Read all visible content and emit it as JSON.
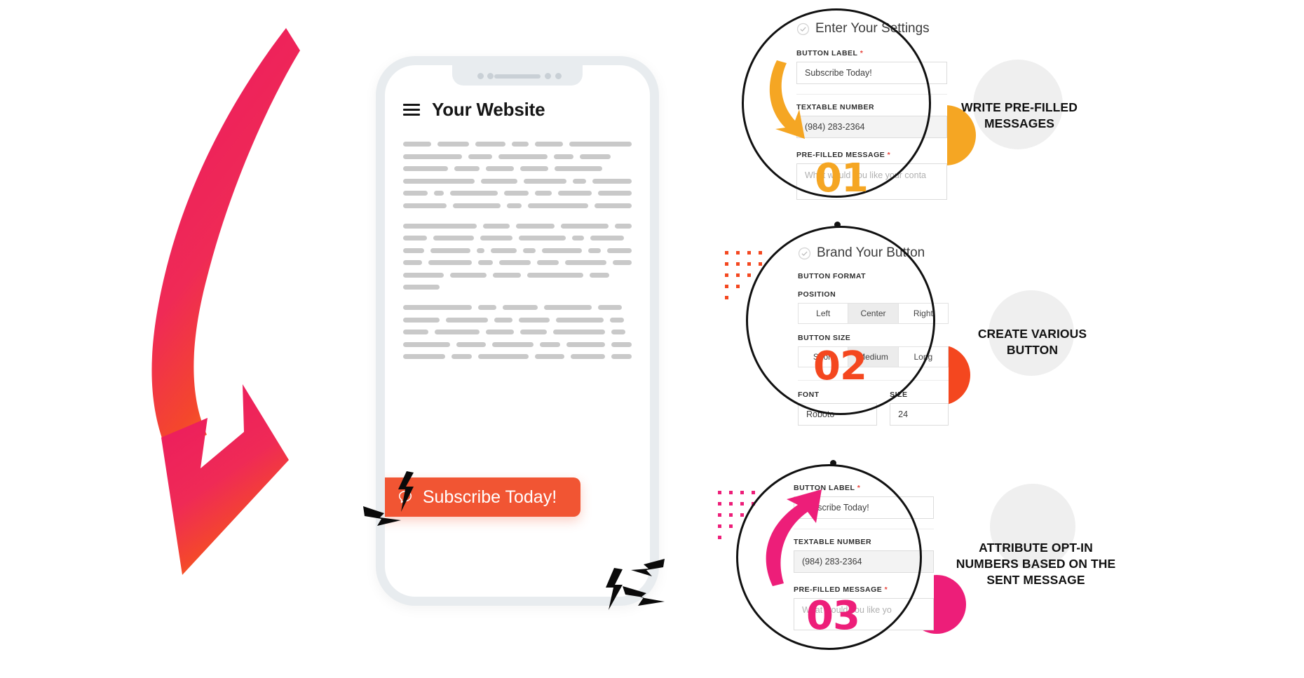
{
  "phone": {
    "site_title": "Your Website",
    "menu_icon": "hamburger-icon",
    "subscribe_button_label": "Subscribe Today!",
    "subscribe_button_icon": "chat-bubble-icon",
    "subscribe_button_color": "#f15533"
  },
  "steps": [
    {
      "number": "01",
      "accent": "#f5a623",
      "title": "Enter Your Settings",
      "status_icon": "check-circle-icon",
      "fields": [
        {
          "label": "BUTTON LABEL",
          "required": true,
          "value": "Subscribe Today!",
          "state": "value"
        },
        {
          "label": "TEXTABLE NUMBER",
          "required": false,
          "value": "(984) 283-2364",
          "state": "filled"
        },
        {
          "label": "PRE-FILLED MESSAGE",
          "required": true,
          "value": "What would you like your conta",
          "state": "placeholder"
        }
      ],
      "caption": "WRITE PRE-FILLED MESSAGES"
    },
    {
      "number": "02",
      "accent": "#f4471f",
      "title": "Brand Your Button",
      "status_icon": "check-circle-icon",
      "group_label": "BUTTON FORMAT",
      "position": {
        "label": "POSITION",
        "options": [
          "Left",
          "Center",
          "Right"
        ],
        "selected": "Center"
      },
      "size": {
        "label": "BUTTON SIZE",
        "options": [
          "Short",
          "Medium",
          "Long"
        ],
        "selected": "Medium"
      },
      "font": {
        "label": "FONT",
        "value": "Roboto"
      },
      "font_size": {
        "label": "SIZE",
        "value": "24"
      },
      "caption": "CREATE VARIOUS BUTTON"
    },
    {
      "number": "03",
      "accent": "#ed1e79",
      "title": "",
      "fields": [
        {
          "label": "BUTTON LABEL",
          "required": true,
          "value": "Subscribe Today!",
          "state": "value"
        },
        {
          "label": "TEXTABLE NUMBER",
          "required": false,
          "value": "(984) 283-2364",
          "state": "filled"
        },
        {
          "label": "PRE-FILLED MESSAGE",
          "required": true,
          "value": "What would you like yo",
          "state": "placeholder"
        }
      ],
      "caption": "ATTRIBUTE OPT-IN NUMBERS BASED ON THE SENT MESSAGE"
    }
  ],
  "colors": {
    "gradient_start": "#ed1e5f",
    "gradient_mid": "#f2462f",
    "gradient_end": "#fa8c14",
    "skeleton": "#c9c9c9",
    "phone_frame": "#e8ecef"
  }
}
